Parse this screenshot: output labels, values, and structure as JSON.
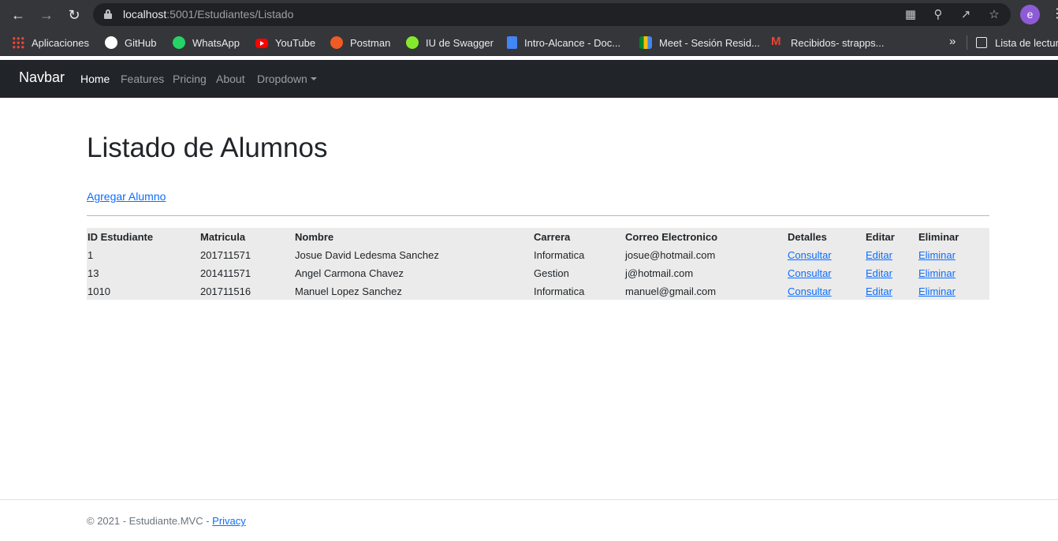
{
  "browser": {
    "url_host": "localhost",
    "url_rest": ":5001/Estudiantes/Listado",
    "avatar_letter": "e",
    "bookmarks": [
      {
        "label": "Aplicaciones",
        "icon": "apps-grid-icon"
      },
      {
        "label": "GitHub",
        "icon": "github-icon"
      },
      {
        "label": "WhatsApp",
        "icon": "whatsapp-icon"
      },
      {
        "label": "YouTube",
        "icon": "youtube-icon"
      },
      {
        "label": "Postman",
        "icon": "postman-icon"
      },
      {
        "label": "IU de Swagger",
        "icon": "swagger-icon"
      },
      {
        "label": "Intro-Alcance - Doc...",
        "icon": "google-docs-icon"
      },
      {
        "label": "Meet - Sesión Resid...",
        "icon": "google-meet-icon"
      },
      {
        "label": "Recibidos- strapps...",
        "icon": "gmail-icon"
      }
    ],
    "more_bookmarks": "»",
    "reading_list": "Lista de lectura"
  },
  "navbar": {
    "brand": "Navbar",
    "links": [
      "Home",
      "Features",
      "Pricing",
      "About",
      "Dropdown"
    ]
  },
  "main": {
    "title": "Listado de Alumnos",
    "add_link": "Agregar Alumno",
    "table": {
      "headers": [
        "ID Estudiante",
        "Matricula",
        "Nombre",
        "Carrera",
        "Correo Electronico",
        "Detalles",
        "Editar",
        "Eliminar"
      ],
      "rows": [
        {
          "id": "1",
          "matricula": "201711571",
          "nombre": "Josue David Ledesma Sanchez",
          "carrera": "Informatica",
          "correo": "josue@hotmail.com",
          "detalles": "Consultar",
          "editar": "Editar",
          "eliminar": "Eliminar"
        },
        {
          "id": "13",
          "matricula": "201411571",
          "nombre": "Angel Carmona Chavez",
          "carrera": "Gestion",
          "correo": "j@hotmail.com",
          "detalles": "Consultar",
          "editar": "Editar",
          "eliminar": "Eliminar"
        },
        {
          "id": "1010",
          "matricula": "201711516",
          "nombre": "Manuel Lopez Sanchez",
          "carrera": "Informatica",
          "correo": "manuel@gmail.com",
          "detalles": "Consultar",
          "editar": "Editar",
          "eliminar": "Eliminar"
        }
      ]
    }
  },
  "footer": {
    "text": "© 2021 - Estudiante.MVC - ",
    "privacy": "Privacy"
  }
}
